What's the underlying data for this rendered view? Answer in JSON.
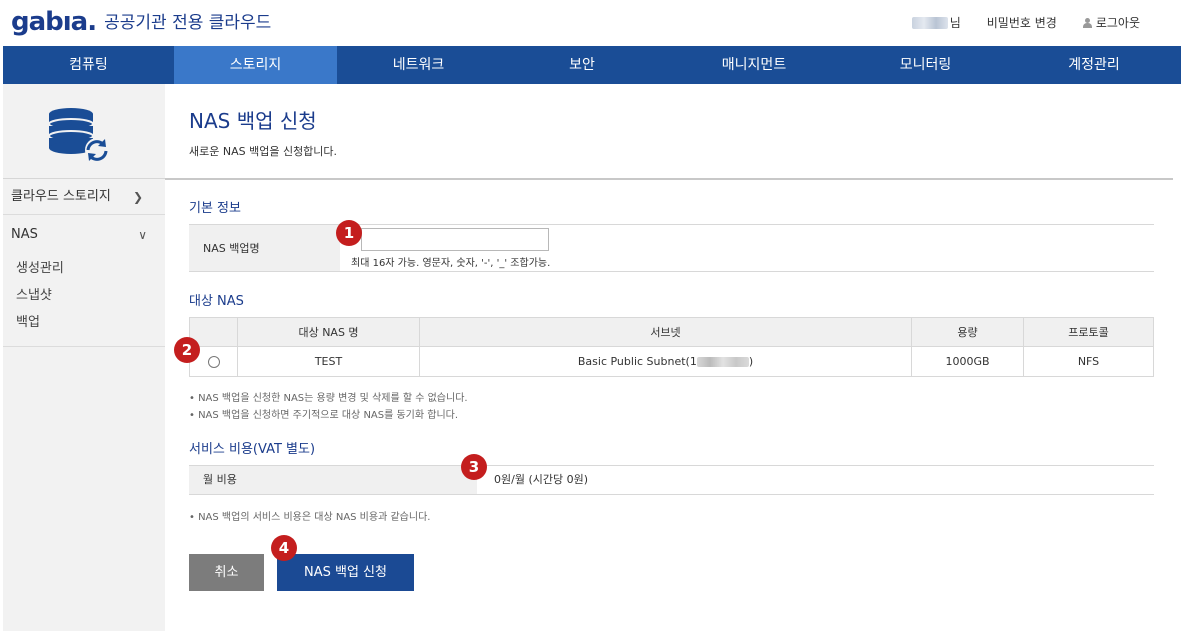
{
  "header": {
    "logo_text": "gabıa.",
    "logo_sub": "공공기관 전용 클라우드",
    "user_suffix": "님",
    "change_password": "비밀번호 변경",
    "logout": "로그아웃"
  },
  "nav": {
    "items": [
      "컴퓨팅",
      "스토리지",
      "네트워크",
      "보안",
      "매니지먼트",
      "모니터링",
      "계정관리"
    ],
    "active": "스토리지"
  },
  "sidebar": {
    "section": "클라우드 스토리지",
    "group": "NAS",
    "sub_items": [
      "생성관리",
      "스냅샷",
      "백업"
    ]
  },
  "page": {
    "title": "NAS 백업 신청",
    "desc": "새로운 NAS 백업을 신청합니다."
  },
  "basic": {
    "heading": "기본 정보",
    "label": "NAS 백업명",
    "value": "",
    "hint": "최대 16자 가능. 영문자, 숫자, '-', '_' 조합가능."
  },
  "target": {
    "heading": "대상 NAS",
    "columns": [
      "",
      "대상 NAS 명",
      "서브넷",
      "용량",
      "프로토콜"
    ],
    "rows": [
      {
        "name": "TEST",
        "subnet": "Basic Public Subnet(1",
        "subnet_end": ")",
        "capacity": "1000GB",
        "protocol": "NFS"
      }
    ],
    "notes": [
      "• NAS 백업을 신청한 NAS는 용량 변경 및 삭제를 할 수 없습니다.",
      "• NAS 백업을 신청하면 주기적으로 대상 NAS를 동기화 합니다."
    ]
  },
  "cost": {
    "heading": "서비스 비용(VAT 별도)",
    "label": "월 비용",
    "value": "0원/월 (시간당 0원)",
    "note": "• NAS 백업의 서비스 비용은 대상 NAS 비용과 같습니다."
  },
  "buttons": {
    "cancel": "취소",
    "submit": "NAS 백업 신청"
  },
  "badges": [
    "1",
    "2",
    "3",
    "4"
  ],
  "colors": {
    "brand": "#1b3c8c",
    "nav_bg": "#1a4d96",
    "nav_active": "#3a78c9",
    "badge": "#c41e1e",
    "submit": "#1b4a94",
    "cancel": "#7c7c7c"
  }
}
